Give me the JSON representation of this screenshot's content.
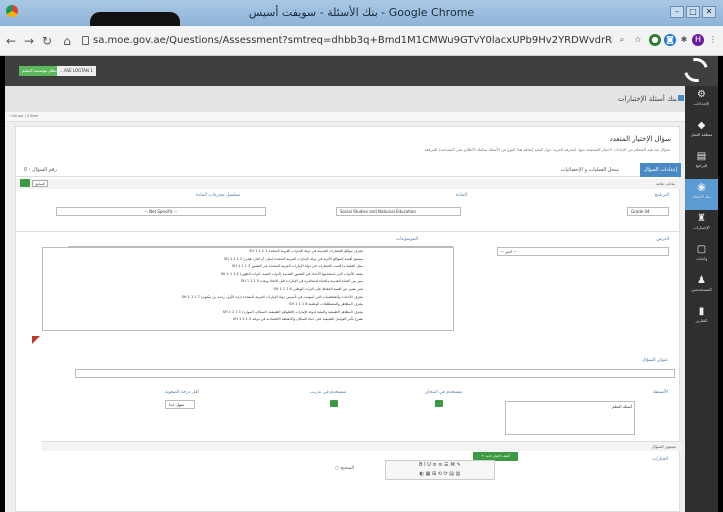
{
  "window": {
    "title": "بنك الأسئلة - سويفت أسيس - Google Chrome",
    "buttons": [
      "–",
      "□",
      "✕"
    ]
  },
  "browser": {
    "url": "sa.moe.gov.ae/Questions/Assessment?smtreq=dhbb3q+Bmd1M1CMWu9GTvY0lacxUPb9Hv2YRDWvdrRbeQL15a1pcLRfTgK6Ul2XVrswDwfK/6AAnNt+6...",
    "profile_initial": "H"
  },
  "topbar": {
    "button1": "...ASE LOGTAN 1",
    "button2": "نظام مؤسسة التعليم"
  },
  "header": {
    "title": "بنك أسئلة الإختبارات",
    "crumb": "› bill par | 0 item"
  },
  "sidebar": [
    {
      "icon": "⚙",
      "label": "الإعدادات"
    },
    {
      "icon": "◆",
      "label": "منطقة العمل"
    },
    {
      "icon": "▤",
      "label": "البرامج"
    },
    {
      "icon": "◉",
      "label": "بنك الأسئلة"
    },
    {
      "icon": "♜",
      "label": "الإختبارات"
    },
    {
      "icon": "▢",
      "label": "واجبات"
    },
    {
      "icon": "♟",
      "label": "المستخدمين"
    },
    {
      "icon": "▮",
      "label": "التقارير"
    }
  ],
  "form": {
    "title": "سؤال الإختيار المتعدد",
    "subtitle": "سؤال يعد فيه المتعلم من الإجابات لاختيار الصحيحة منها. لمعرفة المزيد حول كيفية إضافة هذا النوع من الأسئلة يمكنك الاطلاع على المساعدة المرفقة.",
    "tab_active": "إعدادات السؤال",
    "tab_2": "سجل العمليات و الإحصائيات",
    "question_no": "رقم السؤال : 0",
    "general_data": "بيانات عامة",
    "small_btn": "السابق",
    "program_label": "البرنامج",
    "program_value": "Grade 04",
    "subject_label": "المادة",
    "subject_value": "Social Studies and National Education",
    "spec_label": "تسلسل مخرجات المادة",
    "spec_value": "-- Not Specific --",
    "lesson_label": "الدرس",
    "lesson_value": "-- اختر --",
    "topics_label": "الموضوعات",
    "tree": [
      "SH 1 1 1 1 يتعرف مواقع الحضارات القديمة في دولة الإمارات العربية المتحدة",
      "SH 1 1 1 2 يستنتج أهمية المواقع الأثرية في دولة الإمارات العربية المتحدة (مثل: أم النار، هيلي)",
      "SH 1 1 1 3 يمثل القصة ما قامت الحضارات في دولة الإمارات العربية المتحدة عبر العصور",
      "SH 1 1 1 4 يصف الأدوات التي استخدمها الأجداد في العصور القديمة (أدوات الصيد، أدوات الطهي)",
      "SH 1 1 1 5 يميز بين الحياة القديمة والحياة المعاصرة في الإمارات قبل الاتحاد وبعده",
      "SH 1 1 1 6 يعبر بتعبير عن أهمية الحفاظ على التراث الوطني",
      "SH 1 1 1 7 يتعرف الأحداث والشخصيات التي أسهمت في تأسيس دولة الإمارات العربية المتحدة (زايد الأول، راشد بن مكتوم)",
      "SH 1 1 1 8 يتعرف المظاهر والمصطلحات الوطنية",
      "SH 1 2 1 1 يتعرف المظاهر الطبيعية والبيئية لدولة الإمارات (الظواهر الطبيعية، السكان، الموارد)",
      "SH 1 2 1 2 يشرح تأثير العوامل الطبيعية على حياة السكان والأنشطة الاقتصادية في دولته"
    ],
    "q_title_label": "عنوان السؤال",
    "cat_label": "الأنشطة",
    "cat_value": "أسئلة التعلم",
    "exam_label": "مستخدم في امتحان",
    "train_label": "مستخدم في تدريب",
    "diff_label": "أقل درجة الصعوبة",
    "diff_value": "سهل جدا",
    "content_label": "محتوى السؤال",
    "options_label": "الخيارات",
    "add_btn": "+ أضف اختيار جديد",
    "correct_label": "○ الصحيح"
  }
}
